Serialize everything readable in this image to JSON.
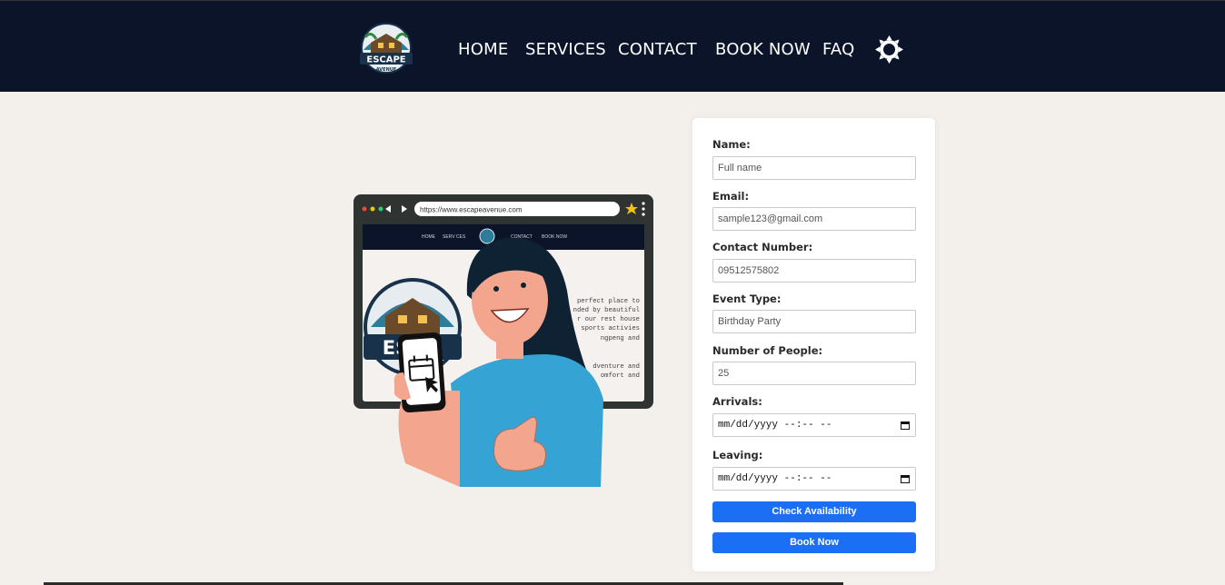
{
  "nav": {
    "logo_text": "ESCAPE",
    "logo_subtext": "AVENUE",
    "items": [
      {
        "label": "HOME"
      },
      {
        "label": "SERVICES"
      },
      {
        "label": "CONTACT"
      },
      {
        "label": "BOOK NOW"
      },
      {
        "label": "FAQ"
      }
    ]
  },
  "illustration": {
    "url": "https://www.escapeavenue.com",
    "mini_nav": [
      "HOME",
      "SERV CES",
      "CONTACT",
      "BOOK NOW"
    ],
    "logo_text": "ESC   E",
    "blurred_text": [
      "perfect place to",
      "nded by beautiful",
      "r our rest house",
      "sports activies",
      "ngpeng and",
      "dventure and",
      "omfort and"
    ]
  },
  "form": {
    "name": {
      "label": "Name:",
      "placeholder": "Full name"
    },
    "email": {
      "label": "Email:",
      "value": "sample123@gmail.com"
    },
    "contact": {
      "label": "Contact Number:",
      "value": "09512575802"
    },
    "event_type": {
      "label": "Event Type:",
      "value": "Birthday Party"
    },
    "people": {
      "label": "Number of People:",
      "value": "25"
    },
    "arrivals": {
      "label": "Arrivals:",
      "value": "mm/dd/yyyy --:-- --"
    },
    "leaving": {
      "label": "Leaving:",
      "value": "mm/dd/yyyy --:-- --"
    },
    "check_label": "Check Availability",
    "book_label": "Book Now"
  },
  "colors": {
    "header_bg": "#0b1429",
    "page_bg": "#f3f0ec",
    "button": "#1a6ff5"
  }
}
